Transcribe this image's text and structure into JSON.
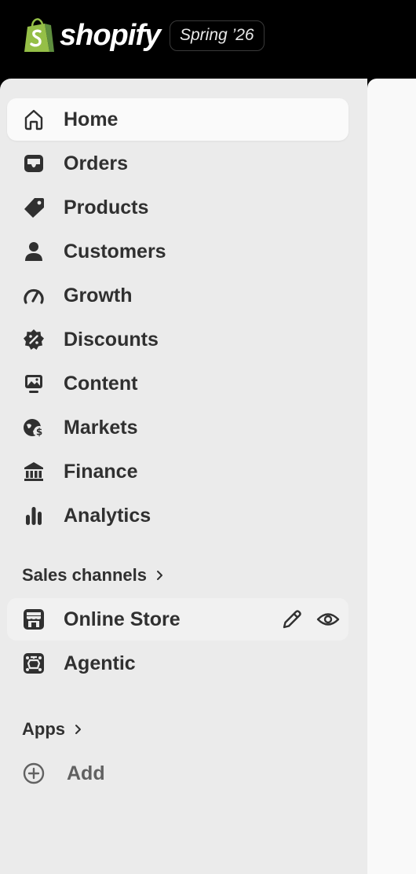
{
  "brand": {
    "name": "shopify",
    "edition": "Spring ’26"
  },
  "nav": {
    "items": [
      {
        "label": "Home",
        "icon": "home-icon"
      },
      {
        "label": "Orders",
        "icon": "inbox-icon"
      },
      {
        "label": "Products",
        "icon": "tag-icon"
      },
      {
        "label": "Customers",
        "icon": "person-icon"
      },
      {
        "label": "Growth",
        "icon": "gauge-icon"
      },
      {
        "label": "Discounts",
        "icon": "discount-badge-icon"
      },
      {
        "label": "Content",
        "icon": "image-monitor-icon"
      },
      {
        "label": "Markets",
        "icon": "globe-dollar-icon"
      },
      {
        "label": "Finance",
        "icon": "bank-icon"
      },
      {
        "label": "Analytics",
        "icon": "bar-chart-icon"
      }
    ]
  },
  "sales_channels": {
    "heading": "Sales channels",
    "items": [
      {
        "label": "Online Store",
        "icon": "storefront-icon"
      },
      {
        "label": "Agentic",
        "icon": "agent-node-icon"
      }
    ]
  },
  "apps": {
    "heading": "Apps",
    "add_label": "Add"
  },
  "colors": {
    "topbar": "#000000",
    "sidebar": "#ebebeb",
    "active": "#fafafa",
    "text": "#303030"
  }
}
